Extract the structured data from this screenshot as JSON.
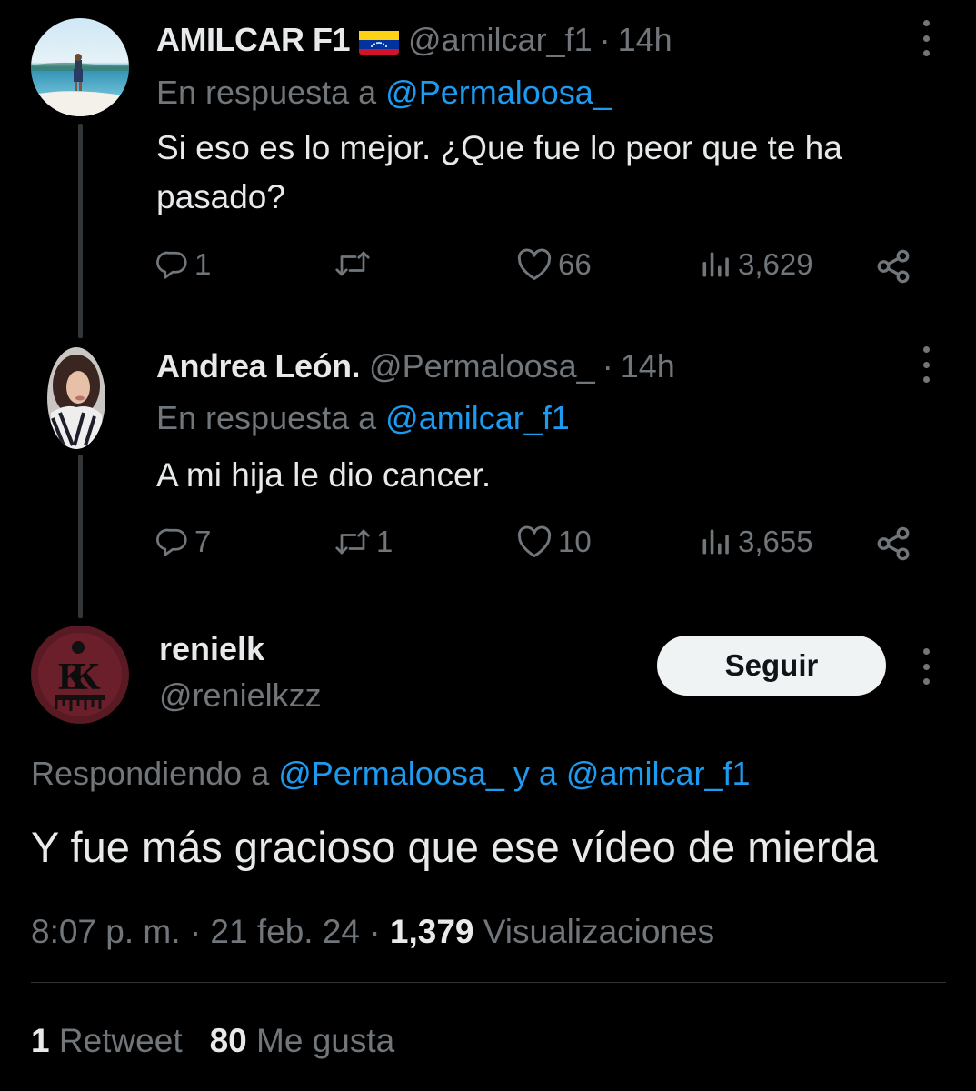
{
  "tweets": [
    {
      "name": "AMILCAR F1",
      "flag_icon": "venezuela-flag-icon",
      "handle": "@amilcar_f1",
      "separator": "·",
      "time": "14h",
      "reply_prefix": "En respuesta a",
      "reply_mention": "@Permaloosa_",
      "text": "Si eso es lo mejor. ¿Que fue lo peor que te ha pasado?",
      "replies": "1",
      "retweets": "",
      "likes": "66",
      "views": "3,629"
    },
    {
      "name": "Andrea León.",
      "handle": "@Permaloosa_",
      "separator": "·",
      "time": "14h",
      "reply_prefix": "En respuesta a",
      "reply_mention": "@amilcar_f1",
      "text": "A mi hija le dio cancer.",
      "replies": "7",
      "retweets": "1",
      "likes": "10",
      "views": "3,655"
    }
  ],
  "main": {
    "name": "renielk",
    "handle": "@renielkzz",
    "follow_label": "Seguir",
    "replying_prefix": "Respondiendo a",
    "replying_mentions": "@Permaloosa_ y a @amilcar_f1",
    "text": "Y fue más gracioso que ese vídeo de mierda",
    "time": "8:07 p. m.",
    "date": "21 feb. 24",
    "views_count": "1,379",
    "views_label": "Visualizaciones",
    "separator": "·",
    "retweets_count": "1",
    "retweets_label": "Retweet",
    "likes_count": "80",
    "likes_label": "Me gusta"
  },
  "colors": {
    "background": "#000000",
    "text": "#e7e9ea",
    "muted": "#71767b",
    "link": "#1d9bf0",
    "button_bg": "#eff3f4"
  }
}
